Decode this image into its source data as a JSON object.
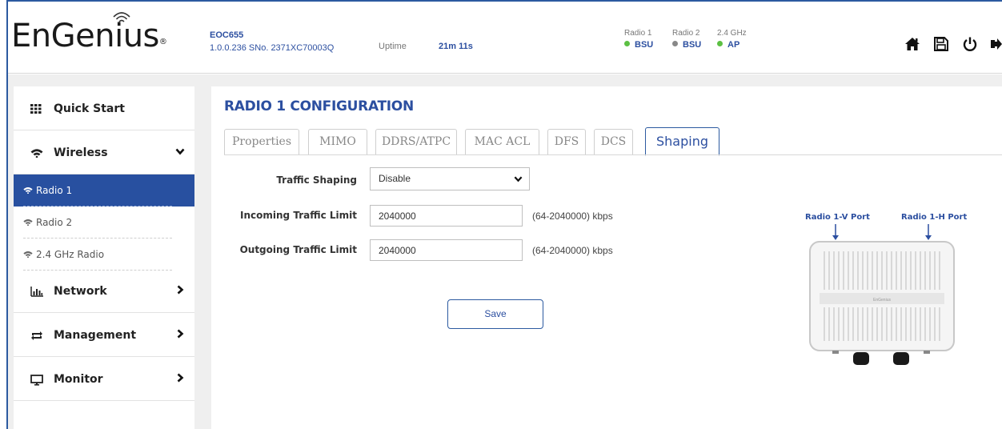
{
  "header": {
    "logo": "EnGenius",
    "logo_mark": "®",
    "model": "EOC655",
    "info": "1.0.0.236 SNo. 2371XC70003Q",
    "uptime_label": "Uptime",
    "uptime_value": "21m 11s",
    "radios": [
      {
        "label": "Radio 1",
        "mode": "BSU",
        "status_color": "#5cc043"
      },
      {
        "label": "Radio 2",
        "mode": "BSU",
        "status_color": "#888888"
      },
      {
        "label": "2.4 GHz",
        "mode": "AP",
        "status_color": "#5cc043"
      }
    ],
    "icons": [
      "home-icon",
      "save-icon",
      "power-icon",
      "logout-icon"
    ]
  },
  "sidebar": {
    "items": [
      {
        "label": "Quick Start",
        "icon": "grid-icon"
      },
      {
        "label": "Wireless",
        "icon": "wifi-icon",
        "arrow": "chevron-down-icon"
      },
      {
        "label": "Network",
        "icon": "bar-chart-icon",
        "arrow": "chevron-right-icon"
      },
      {
        "label": "Management",
        "icon": "refresh-icon",
        "arrow": "chevron-right-icon"
      },
      {
        "label": "Monitor",
        "icon": "monitor-icon",
        "arrow": "chevron-right-icon"
      }
    ],
    "wireless_sub": [
      {
        "label": "Radio 1",
        "active": true
      },
      {
        "label": "Radio 2",
        "active": false
      },
      {
        "label": "2.4 GHz Radio",
        "active": false
      }
    ]
  },
  "main": {
    "title": "RADIO 1 CONFIGURATION",
    "tabs": [
      "Properties",
      "MIMO",
      "DDRS/ATPC",
      "MAC ACL",
      "DFS",
      "DCS",
      "Shaping"
    ],
    "active_tab": "Shaping",
    "form": {
      "traffic_shaping_label": "Traffic Shaping",
      "traffic_shaping_value": "Disable",
      "incoming_label": "Incoming Traffic Limit",
      "incoming_value": "2040000",
      "incoming_hint": "(64-2040000) kbps",
      "outgoing_label": "Outgoing Traffic Limit",
      "outgoing_value": "2040000",
      "outgoing_hint": "(64-2040000) kbps",
      "save_label": "Save"
    },
    "device": {
      "port_v_label": "Radio 1-V Port",
      "port_h_label": "Radio 1-H Port",
      "brand_mark": "EnGenius"
    }
  },
  "colors": {
    "accent": "#2c4fa0",
    "active_nav": "#2850a0",
    "status_green": "#5cc043",
    "status_gray": "#888888"
  }
}
